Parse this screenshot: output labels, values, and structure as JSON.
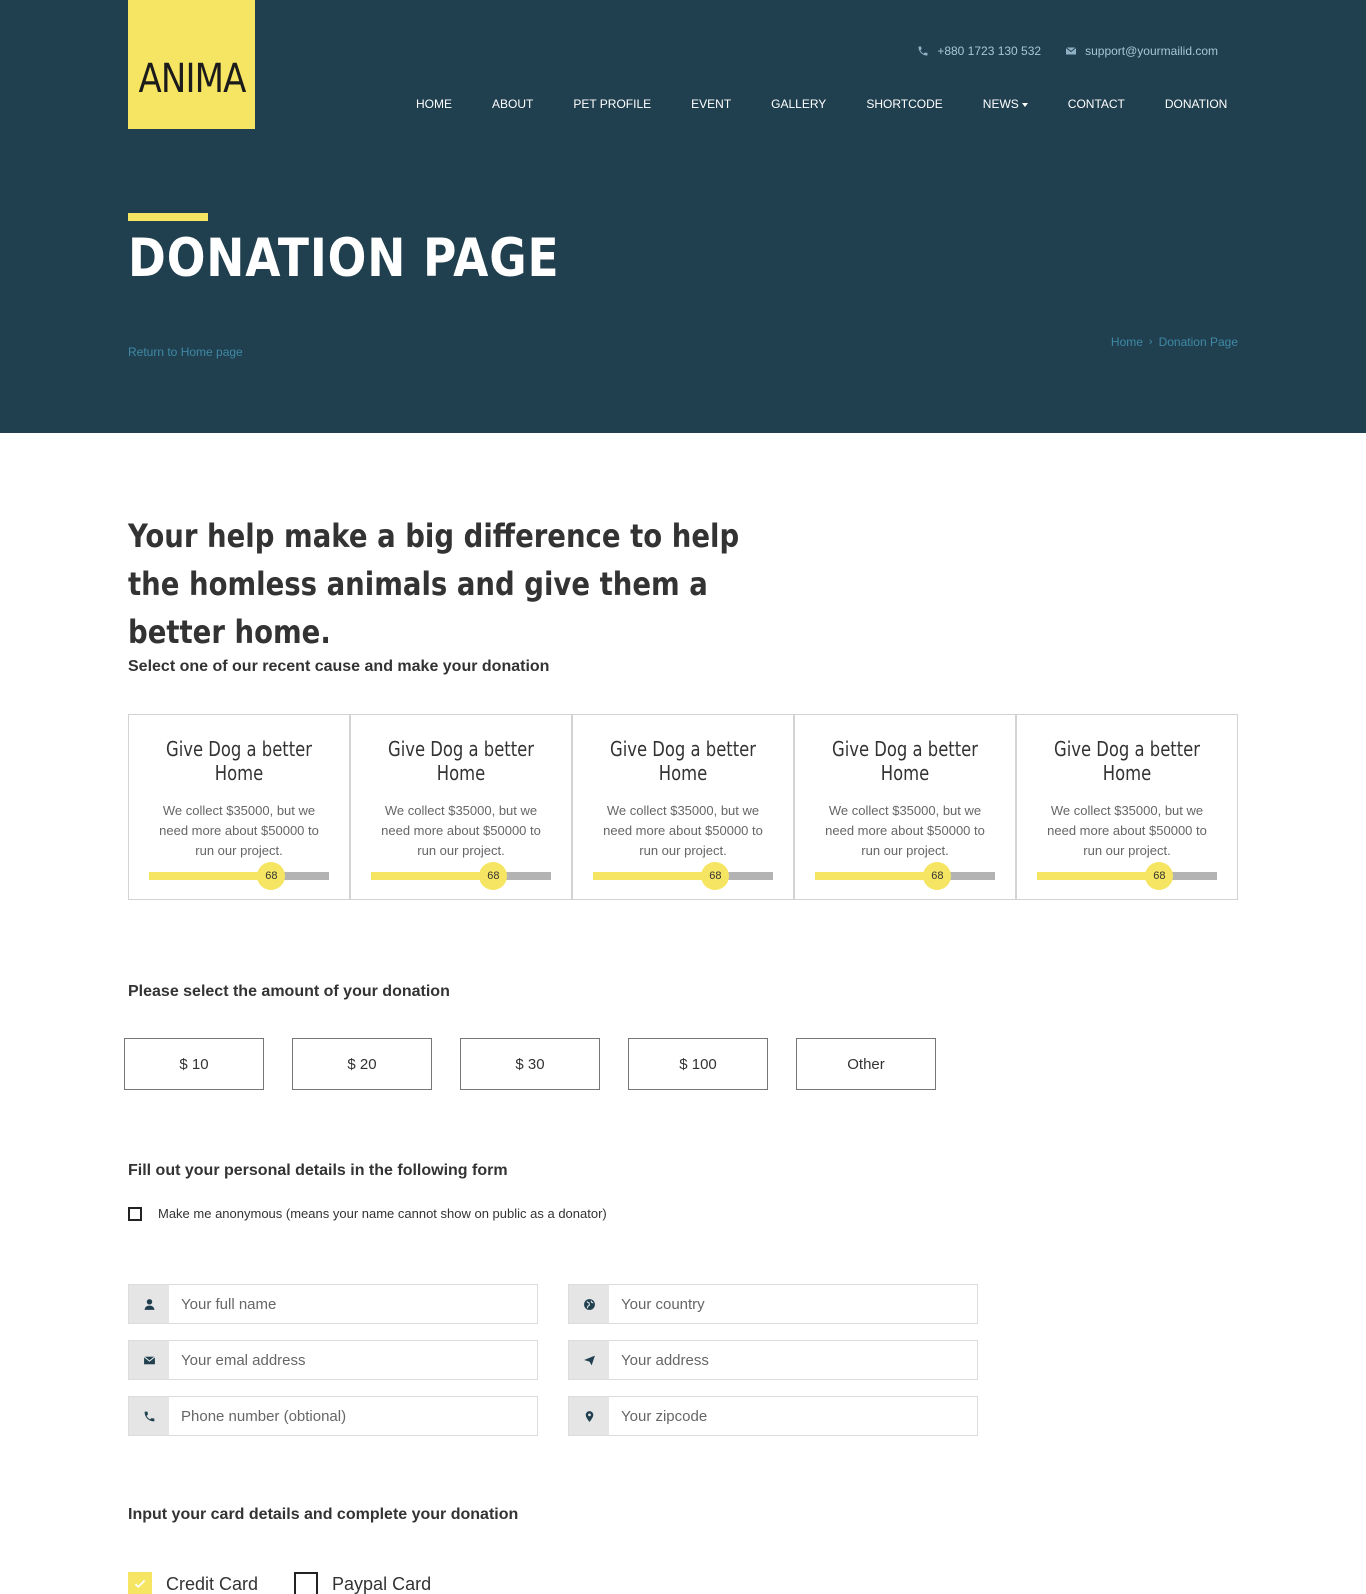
{
  "brand": {
    "logo_text": "ANIMA"
  },
  "colors": {
    "accent": "#f6e562",
    "header_bg": "#203f4f",
    "link": "#3f8aa6"
  },
  "contact": {
    "phone": "+880 1723 130 532",
    "email": "support@yourmailid.com",
    "phone_icon": "phone-icon",
    "email_icon": "envelope-icon"
  },
  "nav": {
    "items": [
      "HOME",
      "ABOUT",
      "PET PROFILE",
      "EVENT",
      "GALLERY",
      "SHORTCODE",
      "NEWS",
      "CONTACT",
      "DONATION"
    ]
  },
  "hero": {
    "title": "DONATION PAGE",
    "return_link": "Return to Home page",
    "breadcrumb": [
      "Home",
      "Donation Page"
    ]
  },
  "headline": "Your help make a big difference to help the homless animals and give them a better home.",
  "causes_section": {
    "label": "Select one of our recent cause and make your donation"
  },
  "causes": [
    {
      "title": "Give Dog a better Home",
      "desc": "We collect $35000, but we need more about $50000 to run our project.",
      "progress": 68
    },
    {
      "title": "Give Dog a better Home",
      "desc": "We collect $35000, but we need more about $50000 to run our project.",
      "progress": 68
    },
    {
      "title": "Give Dog a better Home",
      "desc": "We collect $35000, but we need more about $50000 to run our project.",
      "progress": 68
    },
    {
      "title": "Give Dog a better Home",
      "desc": "We collect $35000, but we need more about $50000 to run our project.",
      "progress": 68
    },
    {
      "title": "Give Dog a better Home",
      "desc": "We collect $35000, but we need more about $50000 to run our project.",
      "progress": 68
    }
  ],
  "amount_section": {
    "label": "Please select the amount of your donation",
    "options": [
      "$ 10",
      "$ 20",
      "$ 30",
      "$ 100",
      "Other"
    ]
  },
  "personal_section": {
    "label": "Fill out your personal details in the following form",
    "anonymous_label": "Make me anonymous (means your name cannot show on public as a donator)",
    "fields": [
      {
        "name": "full-name-field",
        "icon": "user-icon",
        "placeholder": "Your full name"
      },
      {
        "name": "country-field",
        "icon": "globe-icon",
        "placeholder": "Your country"
      },
      {
        "name": "email-field",
        "icon": "envelope-icon",
        "placeholder": "Your emal address"
      },
      {
        "name": "address-field",
        "icon": "paper-plane-icon",
        "placeholder": "Your address"
      },
      {
        "name": "phone-field",
        "icon": "phone-icon",
        "placeholder": "Phone number (obtional)"
      },
      {
        "name": "zipcode-field",
        "icon": "map-marker-icon",
        "placeholder": "Your zipcode"
      }
    ]
  },
  "card_section": {
    "label": "Input your card details and complete your donation",
    "methods": [
      {
        "label": "Credit Card",
        "checked": true
      },
      {
        "label": "Paypal Card",
        "checked": false
      }
    ]
  }
}
